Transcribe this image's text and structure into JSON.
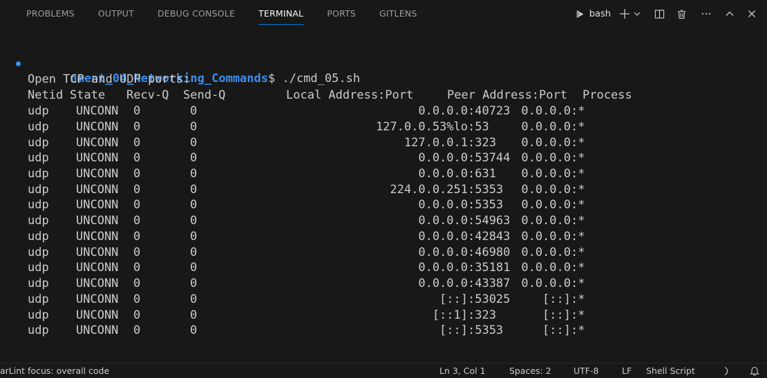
{
  "panel": {
    "tabs": [
      {
        "label": "PROBLEMS"
      },
      {
        "label": "OUTPUT"
      },
      {
        "label": "DEBUG CONSOLE"
      },
      {
        "label": "TERMINAL"
      },
      {
        "label": "PORTS"
      },
      {
        "label": "GITLENS"
      }
    ],
    "active_tab": "TERMINAL",
    "shell_label": "bash",
    "action_icons": [
      "terminal-icon",
      "plus-icon",
      "chevron-down-icon",
      "split-icon",
      "trash-icon",
      "ellipsis-icon",
      "chevron-up-icon",
      "close-icon"
    ]
  },
  "terminal": {
    "prompt_path": "nment_04_Networking_Commands",
    "prompt_suffix": "$ ./cmd_05.sh",
    "info_line": "Open TCP and UDP ports:",
    "header": {
      "netid": "Netid",
      "state": "State",
      "recvq": "Recv-Q",
      "sendq": "Send-Q",
      "local": "Local Address:Port",
      "peer": "Peer Address:Port",
      "process": "Process"
    },
    "rows": [
      {
        "netid": "udp",
        "state": "UNCONN",
        "recvq": "0",
        "sendq": "0",
        "local_addr": "0.0.0.0",
        "local_port": "40723",
        "peer_addr": "0.0.0.0",
        "peer_port": "*"
      },
      {
        "netid": "udp",
        "state": "UNCONN",
        "recvq": "0",
        "sendq": "0",
        "local_addr": "127.0.0.53%lo",
        "local_port": "53",
        "peer_addr": "0.0.0.0",
        "peer_port": "*"
      },
      {
        "netid": "udp",
        "state": "UNCONN",
        "recvq": "0",
        "sendq": "0",
        "local_addr": "127.0.0.1",
        "local_port": "323",
        "peer_addr": "0.0.0.0",
        "peer_port": "*"
      },
      {
        "netid": "udp",
        "state": "UNCONN",
        "recvq": "0",
        "sendq": "0",
        "local_addr": "0.0.0.0",
        "local_port": "53744",
        "peer_addr": "0.0.0.0",
        "peer_port": "*"
      },
      {
        "netid": "udp",
        "state": "UNCONN",
        "recvq": "0",
        "sendq": "0",
        "local_addr": "0.0.0.0",
        "local_port": "631",
        "peer_addr": "0.0.0.0",
        "peer_port": "*"
      },
      {
        "netid": "udp",
        "state": "UNCONN",
        "recvq": "0",
        "sendq": "0",
        "local_addr": "224.0.0.251",
        "local_port": "5353",
        "peer_addr": "0.0.0.0",
        "peer_port": "*"
      },
      {
        "netid": "udp",
        "state": "UNCONN",
        "recvq": "0",
        "sendq": "0",
        "local_addr": "0.0.0.0",
        "local_port": "5353",
        "peer_addr": "0.0.0.0",
        "peer_port": "*"
      },
      {
        "netid": "udp",
        "state": "UNCONN",
        "recvq": "0",
        "sendq": "0",
        "local_addr": "0.0.0.0",
        "local_port": "54963",
        "peer_addr": "0.0.0.0",
        "peer_port": "*"
      },
      {
        "netid": "udp",
        "state": "UNCONN",
        "recvq": "0",
        "sendq": "0",
        "local_addr": "0.0.0.0",
        "local_port": "42843",
        "peer_addr": "0.0.0.0",
        "peer_port": "*"
      },
      {
        "netid": "udp",
        "state": "UNCONN",
        "recvq": "0",
        "sendq": "0",
        "local_addr": "0.0.0.0",
        "local_port": "46980",
        "peer_addr": "0.0.0.0",
        "peer_port": "*"
      },
      {
        "netid": "udp",
        "state": "UNCONN",
        "recvq": "0",
        "sendq": "0",
        "local_addr": "0.0.0.0",
        "local_port": "35181",
        "peer_addr": "0.0.0.0",
        "peer_port": "*"
      },
      {
        "netid": "udp",
        "state": "UNCONN",
        "recvq": "0",
        "sendq": "0",
        "local_addr": "0.0.0.0",
        "local_port": "43387",
        "peer_addr": "0.0.0.0",
        "peer_port": "*"
      },
      {
        "netid": "udp",
        "state": "UNCONN",
        "recvq": "0",
        "sendq": "0",
        "local_addr": "[::]",
        "local_port": "53025",
        "peer_addr": "[::]",
        "peer_port": "*"
      },
      {
        "netid": "udp",
        "state": "UNCONN",
        "recvq": "0",
        "sendq": "0",
        "local_addr": "[::1]",
        "local_port": "323",
        "peer_addr": "[::]",
        "peer_port": "*"
      },
      {
        "netid": "udp",
        "state": "UNCONN",
        "recvq": "0",
        "sendq": "0",
        "local_addr": "[::]",
        "local_port": "5353",
        "peer_addr": "[::]",
        "peer_port": "*"
      }
    ]
  },
  "statusbar": {
    "left_text": "arLint focus: overall code",
    "position": "Ln 3, Col 1",
    "spaces": "Spaces: 2",
    "encoding": "UTF-8",
    "eol": "LF",
    "language": "Shell Script"
  },
  "colors": {
    "background": "#181818",
    "active_tab_underline": "#0078d4",
    "prompt_path": "#3b8eea",
    "terminal_text": "#cccccc"
  }
}
